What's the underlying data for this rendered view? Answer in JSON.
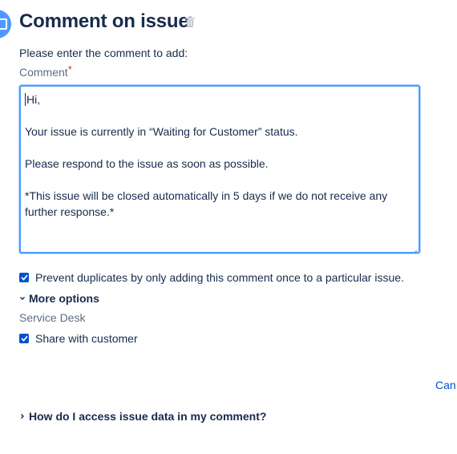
{
  "header": {
    "title": "Comment on issue",
    "icon": "jira-issue-icon",
    "delete_icon": "trash-icon"
  },
  "form": {
    "instruction": "Please enter the comment to add:",
    "comment_label": "Comment",
    "required_marker": "*",
    "comment_lines": [
      "Hi,",
      "",
      "Your issue is currently in “Waiting for Customer” status.",
      "",
      "Please respond to the issue as soon as possible.",
      "",
      "*This issue will be closed automatically in 5 days if we do not receive any further response.*"
    ],
    "prevent_duplicates": {
      "label": "Prevent duplicates by only adding this comment once to a particular issue.",
      "checked": true
    },
    "more_options_label": "More options",
    "service_desk_label": "Service Desk",
    "share_with_customer": {
      "label": "Share with customer",
      "checked": true
    }
  },
  "actions": {
    "cancel_label": "Can"
  },
  "help": {
    "label": "How do I access issue data in my comment?"
  },
  "colors": {
    "accent": "#0052cc",
    "focus_border": "#4c9aff",
    "text": "#172b4d",
    "subtle_text": "#5e6c84",
    "required": "#de350b"
  }
}
